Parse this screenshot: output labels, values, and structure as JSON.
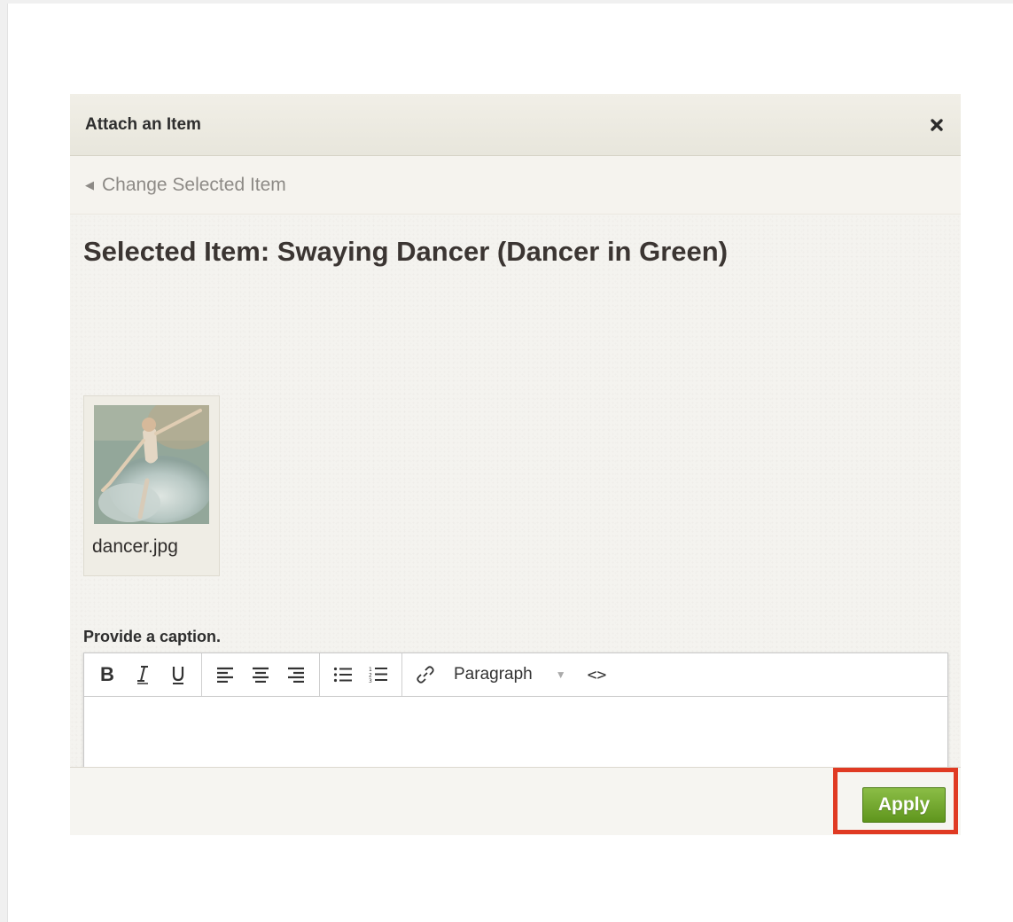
{
  "modal": {
    "title": "Attach an Item",
    "close_icon": "close-icon"
  },
  "subnav": {
    "back_label": "Change Selected Item",
    "back_icon": "triangle-left-icon"
  },
  "selected": {
    "title": "Selected Item: Swaying Dancer (Dancer in Green)",
    "file_name": "dancer.jpg"
  },
  "caption": {
    "label": "Provide a caption.",
    "format_value": "Paragraph",
    "toolbar": {
      "bold": "B",
      "italic": "I",
      "underline": "U",
      "code": "<>"
    }
  },
  "footer": {
    "apply_label": "Apply"
  },
  "colors": {
    "apply_green": "#6fa52b",
    "highlight_red": "#e03a23"
  }
}
